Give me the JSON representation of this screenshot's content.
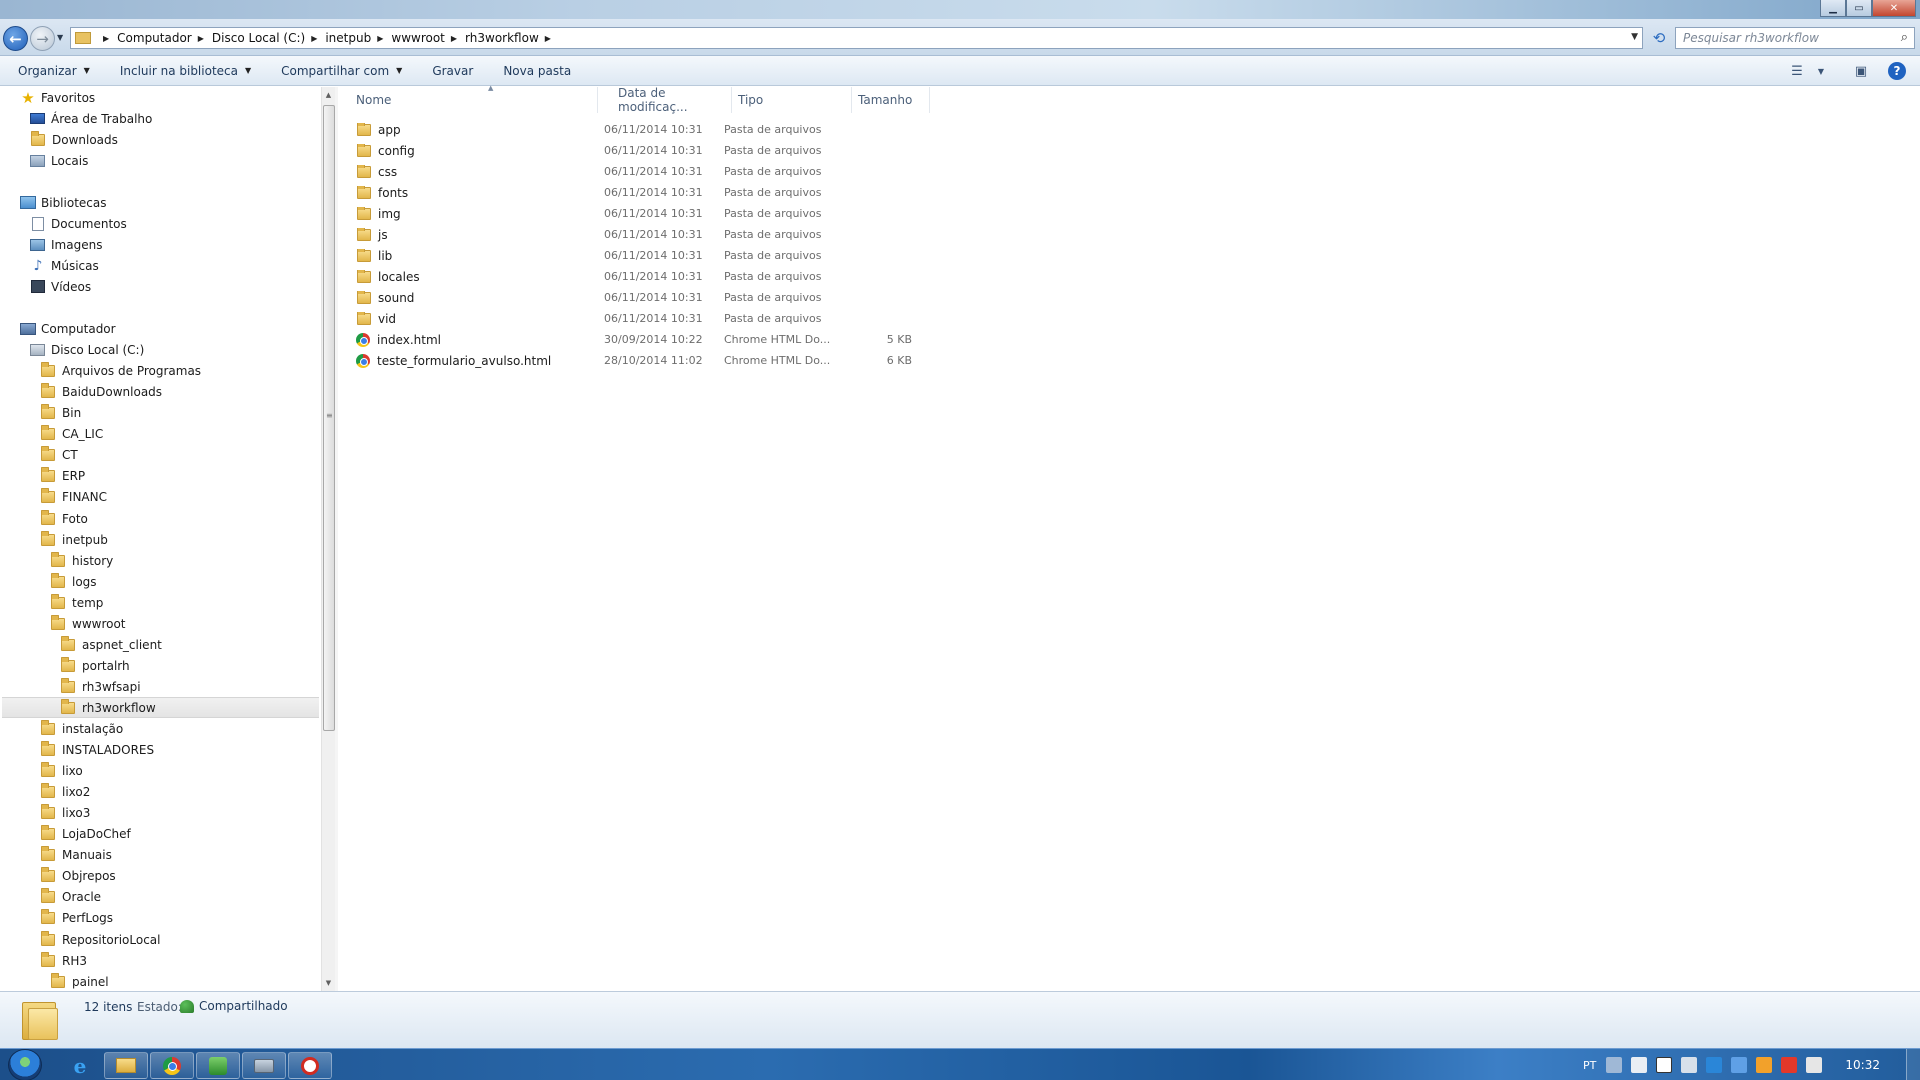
{
  "window": {
    "minimize": "▁",
    "maximize": "▭",
    "close": "✕"
  },
  "address": {
    "crumbs": [
      "Computador",
      "Disco Local (C:)",
      "inetpub",
      "wwwroot",
      "rh3workflow"
    ],
    "search_placeholder": "Pesquisar rh3workflow"
  },
  "toolbar": {
    "organize": "Organizar",
    "include_library": "Incluir na biblioteca",
    "share_with": "Compartilhar com",
    "burn": "Gravar",
    "new_folder": "Nova pasta"
  },
  "nav": {
    "favorites": "Favoritos",
    "favorites_items": [
      "Área de Trabalho",
      "Downloads",
      "Locais"
    ],
    "libraries": "Bibliotecas",
    "libraries_items": [
      "Documentos",
      "Imagens",
      "Músicas",
      "Vídeos"
    ],
    "computer": "Computador",
    "local_disk": "Disco Local (C:)",
    "c_folders_top": [
      "Arquivos de Programas",
      "BaiduDownloads",
      "Bin",
      "CA_LIC",
      "CT",
      "ERP",
      "FINANC",
      "Foto",
      "inetpub"
    ],
    "inetpub_children": [
      "history",
      "logs",
      "temp",
      "wwwroot"
    ],
    "wwwroot_children": [
      "aspnet_client",
      "portalrh",
      "rh3wfsapi",
      "rh3workflow"
    ],
    "c_folders_bottom": [
      "instalação",
      "INSTALADORES",
      "lixo",
      "lixo2",
      "lixo3",
      "LojaDoChef",
      "Manuais",
      "Objrepos",
      "Oracle",
      "PerfLogs",
      "RepositorioLocal",
      "RH3"
    ],
    "rh3_children": [
      "painel"
    ],
    "selected": "rh3workflow"
  },
  "columns": {
    "name": "Nome",
    "date": "Data de modificaç...",
    "type": "Tipo",
    "size": "Tamanho"
  },
  "files": [
    {
      "name": "app",
      "date": "06/11/2014 10:31",
      "type": "Pasta de arquivos",
      "size": "",
      "icon": "folder"
    },
    {
      "name": "config",
      "date": "06/11/2014 10:31",
      "type": "Pasta de arquivos",
      "size": "",
      "icon": "folder"
    },
    {
      "name": "css",
      "date": "06/11/2014 10:31",
      "type": "Pasta de arquivos",
      "size": "",
      "icon": "folder"
    },
    {
      "name": "fonts",
      "date": "06/11/2014 10:31",
      "type": "Pasta de arquivos",
      "size": "",
      "icon": "folder"
    },
    {
      "name": "img",
      "date": "06/11/2014 10:31",
      "type": "Pasta de arquivos",
      "size": "",
      "icon": "folder"
    },
    {
      "name": "js",
      "date": "06/11/2014 10:31",
      "type": "Pasta de arquivos",
      "size": "",
      "icon": "folder"
    },
    {
      "name": "lib",
      "date": "06/11/2014 10:31",
      "type": "Pasta de arquivos",
      "size": "",
      "icon": "folder"
    },
    {
      "name": "locales",
      "date": "06/11/2014 10:31",
      "type": "Pasta de arquivos",
      "size": "",
      "icon": "folder"
    },
    {
      "name": "sound",
      "date": "06/11/2014 10:31",
      "type": "Pasta de arquivos",
      "size": "",
      "icon": "folder"
    },
    {
      "name": "vid",
      "date": "06/11/2014 10:31",
      "type": "Pasta de arquivos",
      "size": "",
      "icon": "folder"
    },
    {
      "name": "index.html",
      "date": "30/09/2014 10:22",
      "type": "Chrome HTML Do...",
      "size": "5 KB",
      "icon": "chrome"
    },
    {
      "name": "teste_formulario_avulso.html",
      "date": "28/10/2014 11:02",
      "type": "Chrome HTML Do...",
      "size": "6 KB",
      "icon": "chrome"
    }
  ],
  "details": {
    "count": "12 itens",
    "state_label": "Estado:",
    "state": "Compartilhado"
  },
  "taskbar": {
    "lang": "PT",
    "clock": "10:32"
  }
}
